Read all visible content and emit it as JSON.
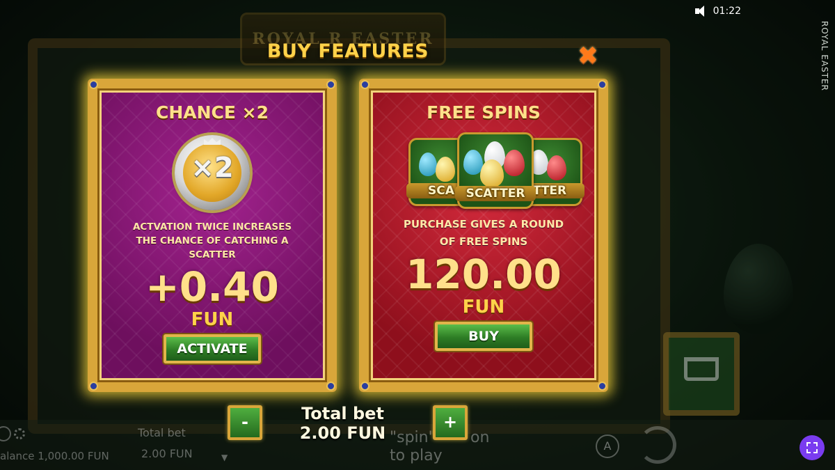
{
  "header": {
    "game_title": "ROYAL EASTER",
    "clock": "01:22",
    "logo_text": "ROYAL R EASTER"
  },
  "popup": {
    "title": "BUY FEATURES",
    "close_icon": "close-icon"
  },
  "cards": [
    {
      "title": "CHANCE ×2",
      "coin_text": "×2",
      "description": "ACTVATION TWICE INCREASES THE CHANCE OF CATCHING A SCATTER",
      "price": "+0.40",
      "currency": "FUN",
      "button_label": "ACTIVATE",
      "background_color": "#8a1a78"
    },
    {
      "title": "FREE SPINS",
      "scatter_labels": [
        "SCA",
        "SCATTER",
        "TTER"
      ],
      "description": "PURCHASE GIVES A ROUND OF FREE SPINS",
      "price": "120.00",
      "currency": "FUN",
      "button_label": "BUY",
      "background_color": "#b81a2c"
    }
  ],
  "bet": {
    "minus_label": "-",
    "plus_label": "+",
    "total_label": "Total bet",
    "total_value": "2.00 FUN"
  },
  "bottom_bar": {
    "balance_text": "alance 1,000.00 FUN",
    "total_bet_label": "Total bet",
    "total_bet_value": "2.00 FUN",
    "spin_hint_1": "\"spin\"",
    "spin_hint_tail": "on",
    "spin_hint_2": "to play",
    "auto_label": "A"
  },
  "colors": {
    "accent_gold": "#ffd24a",
    "button_green": "#2e7d25",
    "fullscreen_purple": "#7a3cf0"
  }
}
